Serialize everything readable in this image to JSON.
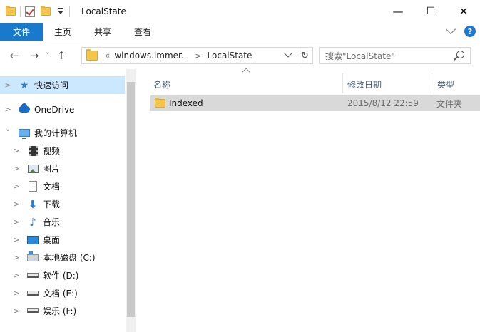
{
  "window": {
    "title": "LocalState",
    "controls": {
      "minimize": "—",
      "maximize": "☐",
      "close": "✕"
    }
  },
  "ribbon": {
    "tabs": [
      "文件",
      "主页",
      "共享",
      "查看"
    ],
    "help": "?"
  },
  "navigation": {
    "back": "←",
    "forward": "→",
    "recent": "˅",
    "up": "↑",
    "breadcrumb": {
      "overflow": "«",
      "items": [
        "windows.immer...",
        "LocalState"
      ]
    },
    "refresh": "↻",
    "search_placeholder": "搜索\"LocalState\""
  },
  "sidebar": {
    "items": [
      {
        "label": "快速访问",
        "icon": "star-icon",
        "selected": true
      },
      {
        "label": "OneDrive",
        "icon": "cloud-icon"
      },
      {
        "label": "我的计算机",
        "icon": "computer-icon",
        "expanded": true
      },
      {
        "label": "视频",
        "icon": "video-icon"
      },
      {
        "label": "图片",
        "icon": "pictures-icon"
      },
      {
        "label": "文档",
        "icon": "document-icon"
      },
      {
        "label": "下载",
        "icon": "download-icon"
      },
      {
        "label": "音乐",
        "icon": "music-icon"
      },
      {
        "label": "桌面",
        "icon": "desktop-icon"
      },
      {
        "label": "本地磁盘 (C:)",
        "icon": "system-drive-icon"
      },
      {
        "label": "软件 (D:)",
        "icon": "drive-icon"
      },
      {
        "label": "文档 (E:)",
        "icon": "drive-icon"
      },
      {
        "label": "娱乐 (F:)",
        "icon": "drive-icon"
      }
    ]
  },
  "content": {
    "columns": [
      "名称",
      "修改日期",
      "类型"
    ],
    "rows": [
      {
        "name": "Indexed",
        "modified": "2015/8/12 22:59",
        "type": "文件夹"
      }
    ]
  },
  "colors": {
    "file_tab": "#1979ca",
    "selected_nav": "#cce8ff",
    "selected_row": "#d9d9d9",
    "column_header": "#4c607a"
  }
}
